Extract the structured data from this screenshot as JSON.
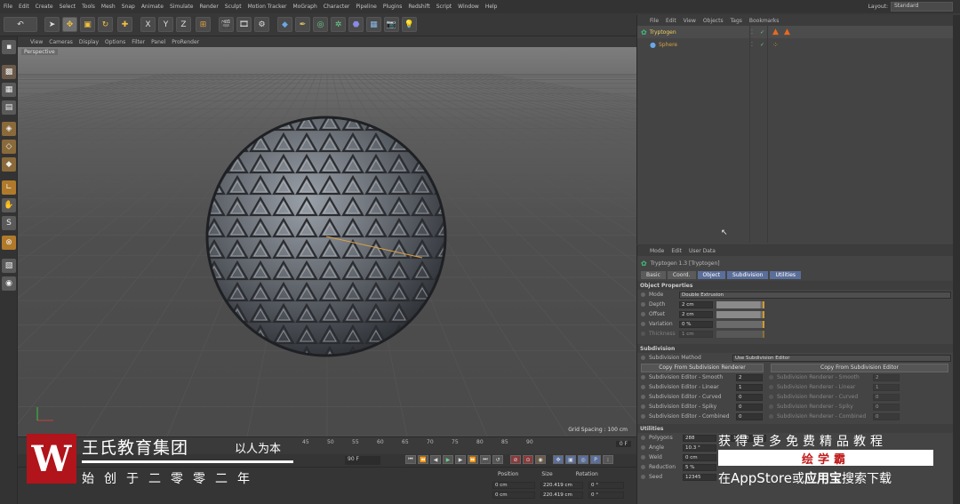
{
  "menubar": {
    "items": [
      "File",
      "Edit",
      "Create",
      "Select",
      "Tools",
      "Mesh",
      "Snap",
      "Animate",
      "Simulate",
      "Render",
      "Sculpt",
      "Motion Tracker",
      "MoGraph",
      "Character",
      "Pipeline",
      "Plugins",
      "Redshift",
      "Script",
      "Window",
      "Help"
    ],
    "layout_label": "Layout:",
    "layout_value": "Standard"
  },
  "toolbar": {
    "x": "X",
    "y": "Y",
    "z": "Z"
  },
  "viewport": {
    "menu": [
      "View",
      "Cameras",
      "Display",
      "Options",
      "Filter",
      "Panel",
      "ProRender"
    ],
    "label": "Perspective",
    "grid_spacing": "Grid Spacing : 100 cm"
  },
  "timeline": {
    "ticks": [
      "45",
      "50",
      "55",
      "60",
      "65",
      "70",
      "75",
      "80",
      "85",
      "90"
    ],
    "frame": "0 F",
    "frame_field": "90 F"
  },
  "coords": {
    "headers": [
      "Position",
      "Size",
      "Rotation"
    ],
    "row1": [
      "0 cm",
      "220.419 cm",
      "0 °"
    ],
    "row2": [
      "0 cm",
      "220.419 cm",
      "0 °"
    ]
  },
  "object_manager": {
    "menu": [
      "File",
      "Edit",
      "View",
      "Objects",
      "Tags",
      "Bookmarks"
    ],
    "objects": [
      {
        "name": "Tryptogen"
      },
      {
        "name": "Sphere"
      }
    ]
  },
  "attribute_manager": {
    "menu": [
      "Mode",
      "Edit",
      "User Data"
    ],
    "title": "Tryptogen 1.3 [Tryptogen]",
    "tabs": [
      "Basic",
      "Coord.",
      "Object",
      "Subdivision",
      "Utilities"
    ],
    "active_tab": 2,
    "sections": {
      "object": "Object Properties",
      "subdivision": "Subdivision",
      "utilities": "Utilities"
    },
    "mode_label": "Mode",
    "mode_value": "Double Extrusion",
    "props": [
      {
        "label": "Depth",
        "value": "2 cm",
        "fill": 0.95
      },
      {
        "label": "Offset",
        "value": "2 cm",
        "fill": 0.95
      },
      {
        "label": "Variation",
        "value": "0 %",
        "fill": 0.0
      },
      {
        "label": "Thickness",
        "value": "1 cm",
        "fill": 0.0
      }
    ],
    "subdiv_method_label": "Subdivision Method",
    "subdiv_method_value": "Use Subdivision Editor",
    "copy_from": "Copy From Subdivision Renderer",
    "copy_to": "Copy From Subdivision Editor",
    "subdiv_left": [
      {
        "label": "Subdivision Editor - Smooth",
        "value": "2"
      },
      {
        "label": "Subdivision Editor - Linear",
        "value": "1"
      },
      {
        "label": "Subdivision Editor - Curved",
        "value": "0"
      },
      {
        "label": "Subdivision Editor - Spiky",
        "value": "0"
      },
      {
        "label": "Subdivision Editor - Combined",
        "value": "0"
      }
    ],
    "subdiv_right": [
      {
        "label": "Subdivision Renderer - Smooth",
        "value": "2"
      },
      {
        "label": "Subdivision Renderer - Linear",
        "value": "1"
      },
      {
        "label": "Subdivision Renderer - Curved",
        "value": "0"
      },
      {
        "label": "Subdivision Renderer - Spiky",
        "value": "0"
      },
      {
        "label": "Subdivision Renderer - Combined",
        "value": "0"
      }
    ],
    "utilities": [
      {
        "label": "Polygons",
        "value": "288"
      },
      {
        "label": "Angle",
        "value": "10.3 °"
      },
      {
        "label": "Weld",
        "value": "0 cm"
      },
      {
        "label": "Reduction",
        "value": "5 %"
      },
      {
        "label": "Seed",
        "value": "12345"
      }
    ],
    "util_right_value": "10000"
  },
  "watermark": {
    "logo": "W",
    "name": "王氏教育集团",
    "slogan": "以人为本",
    "sub": "始创于二零零二年"
  },
  "promo": {
    "line1": "获得更多免费精品教程",
    "line2": "绘学霸",
    "line3_pre": "在",
    "line3_a": "AppStore",
    "line3_mid": "或",
    "line3_b": "应用宝",
    "line3_post": "搜索下载"
  },
  "colors": {
    "accent": "#5a6e9a",
    "slider_mark": "#d49a2a",
    "brand_red": "#b1141b",
    "obj_green": "#3fbf7a"
  }
}
